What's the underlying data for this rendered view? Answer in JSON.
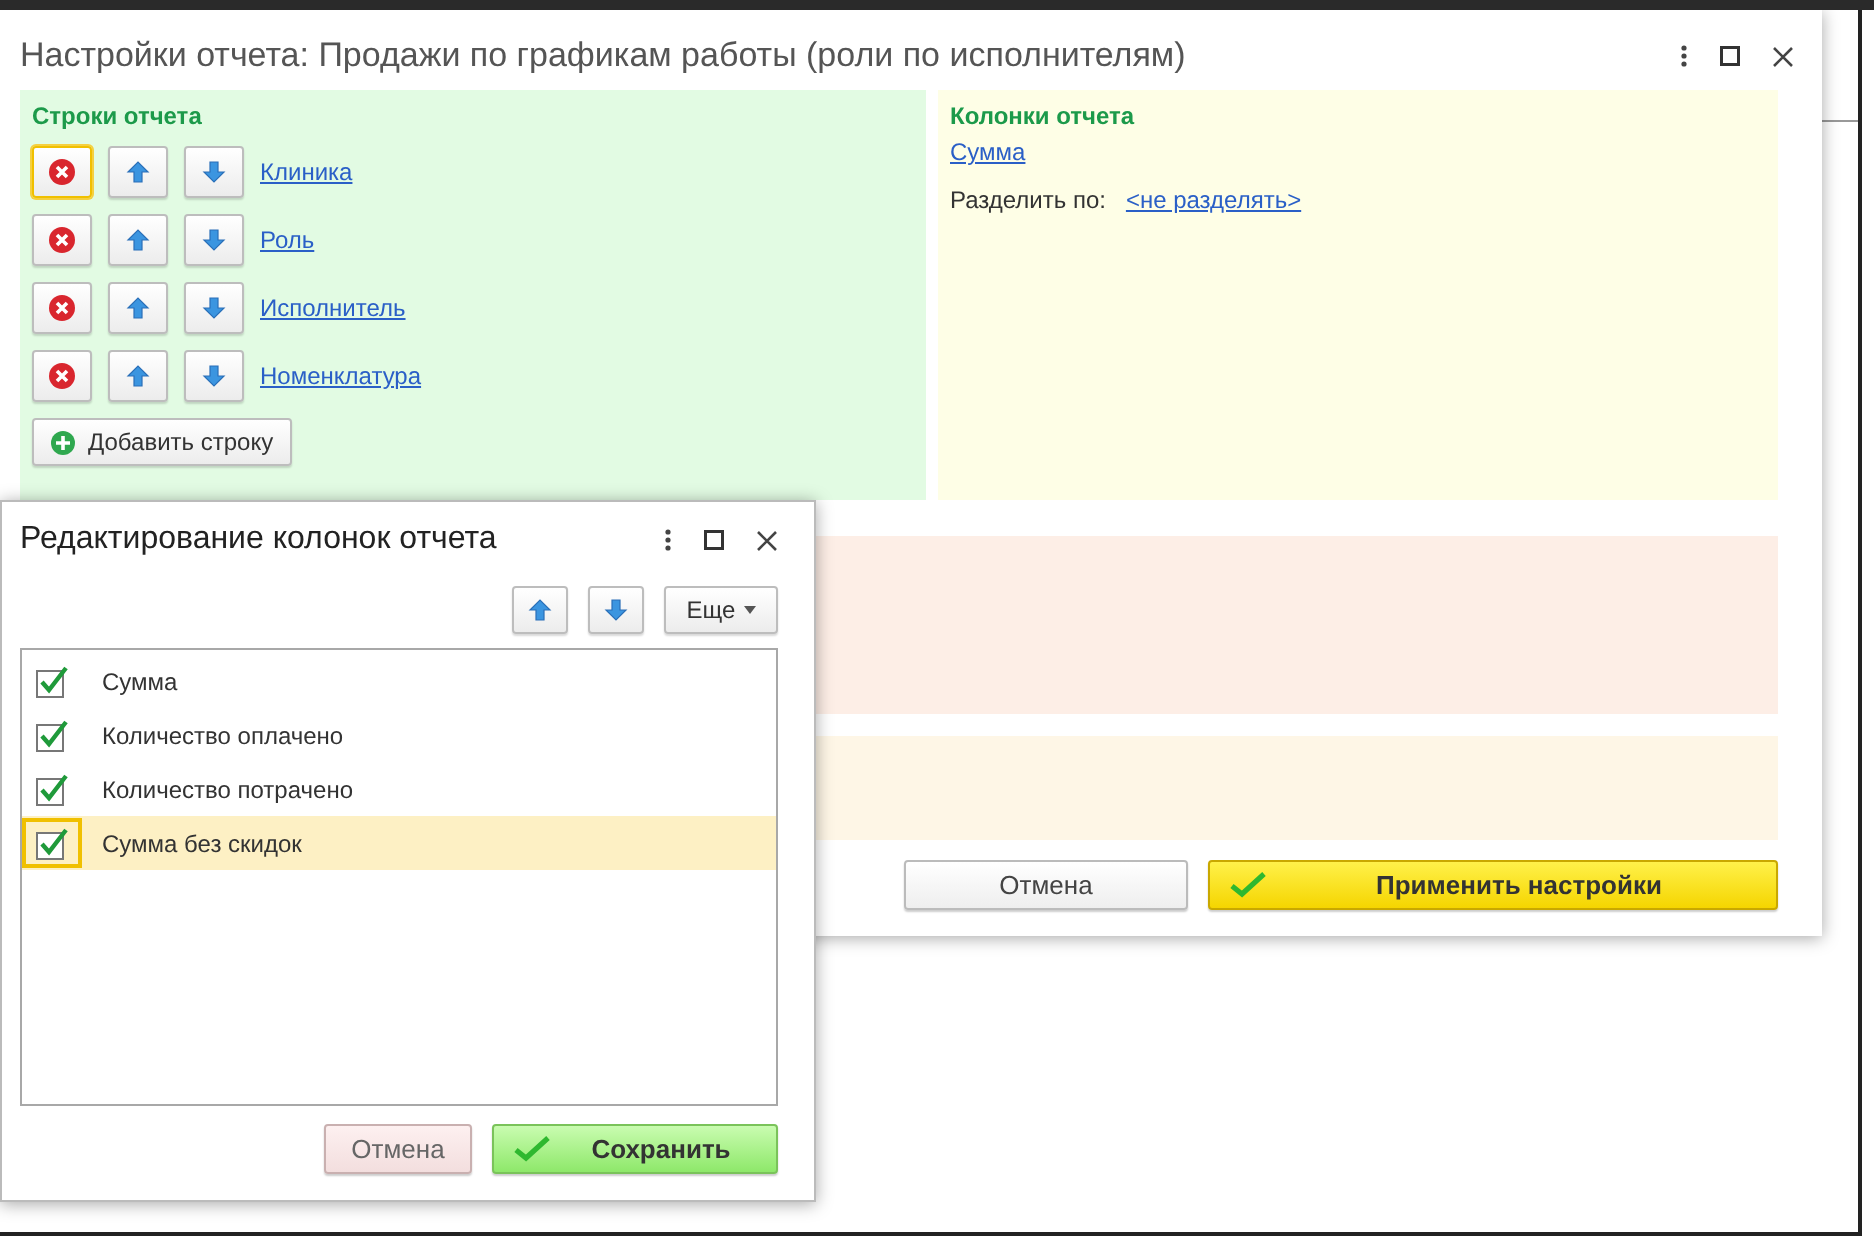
{
  "main_window": {
    "title": "Настройки отчета: Продажи по графикам работы (роли по исполнителям)",
    "rows_section": {
      "title": "Строки отчета",
      "rows": [
        {
          "label": "Клиника",
          "focused": true
        },
        {
          "label": "Роль",
          "focused": false
        },
        {
          "label": "Исполнитель",
          "focused": false
        },
        {
          "label": "Номенклатура",
          "focused": false
        }
      ],
      "add_button": "Добавить строку"
    },
    "columns_section": {
      "title": "Колонки отчета",
      "columns": [
        "Сумма"
      ],
      "split_label": "Разделить по:",
      "split_value": "<не разделять>"
    },
    "buttons": {
      "cancel": "Отмена",
      "apply": "Применить настройки"
    }
  },
  "dialog": {
    "title": "Редактирование колонок отчета",
    "more_button": "Еще",
    "items": [
      {
        "label": "Сумма",
        "checked": true,
        "selected": false
      },
      {
        "label": "Количество оплачено",
        "checked": true,
        "selected": false
      },
      {
        "label": "Количество потрачено",
        "checked": true,
        "selected": false
      },
      {
        "label": "Сумма без скидок",
        "checked": true,
        "selected": true
      }
    ],
    "buttons": {
      "cancel": "Отмена",
      "save": "Сохранить"
    }
  }
}
